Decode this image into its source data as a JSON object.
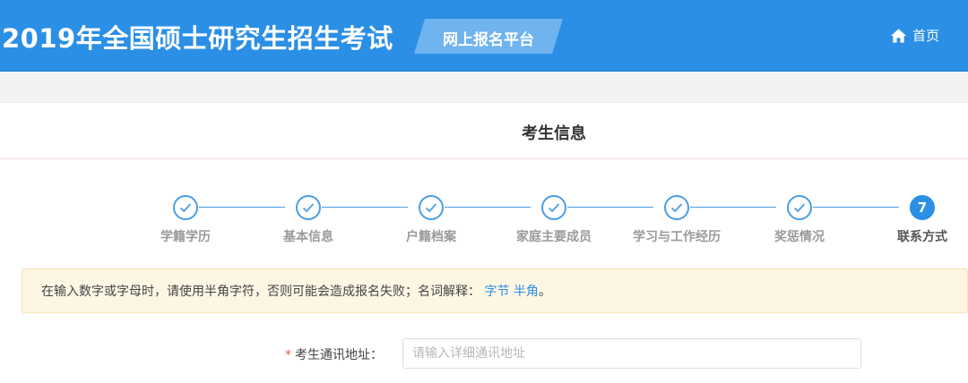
{
  "header": {
    "title": "2019年全国硕士研究生招生考试",
    "platform_label": "网上报名平台",
    "home_label": "首页"
  },
  "panel": {
    "title": "考生信息"
  },
  "steps": [
    {
      "label": "学籍学历",
      "status": "done"
    },
    {
      "label": "基本信息",
      "status": "done"
    },
    {
      "label": "户籍档案",
      "status": "done"
    },
    {
      "label": "家庭主要成员",
      "status": "done"
    },
    {
      "label": "学习与工作经历",
      "status": "done"
    },
    {
      "label": "奖惩情况",
      "status": "done"
    },
    {
      "label": "联系方式",
      "status": "active",
      "number": "7"
    }
  ],
  "notice": {
    "text": "在输入数字或字母时，请使用半角字符，否则可能会造成报名失败；名词解释：",
    "link_bytes": "字节",
    "link_halfwidth": "半角",
    "end": "。"
  },
  "form": {
    "address_label": "考生通讯地址：",
    "required_mark": "*",
    "address_placeholder": "请输入详细通讯地址",
    "address_value": ""
  },
  "colors": {
    "header_bg": "#2b8fe6",
    "accent": "#4a9ee4",
    "notice_bg": "#fdf6e3"
  }
}
